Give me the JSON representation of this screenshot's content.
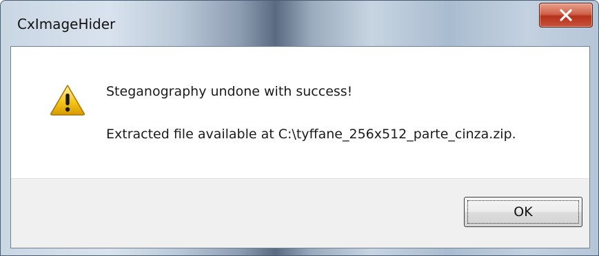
{
  "window": {
    "title": "CxImageHider",
    "close_icon": "close-x-icon"
  },
  "message": {
    "icon": "warning-triangle-icon",
    "line1": "Steganography undone with success!",
    "line2": "Extracted file available at C:\\tyffane_256x512_parte_cinza.zip."
  },
  "buttons": {
    "ok_label": "OK"
  },
  "colors": {
    "close_button": "#c8432b",
    "warning_yellow": "#f5c71a",
    "content_bg": "#ffffff",
    "button_area_bg": "#f0f0f0"
  }
}
